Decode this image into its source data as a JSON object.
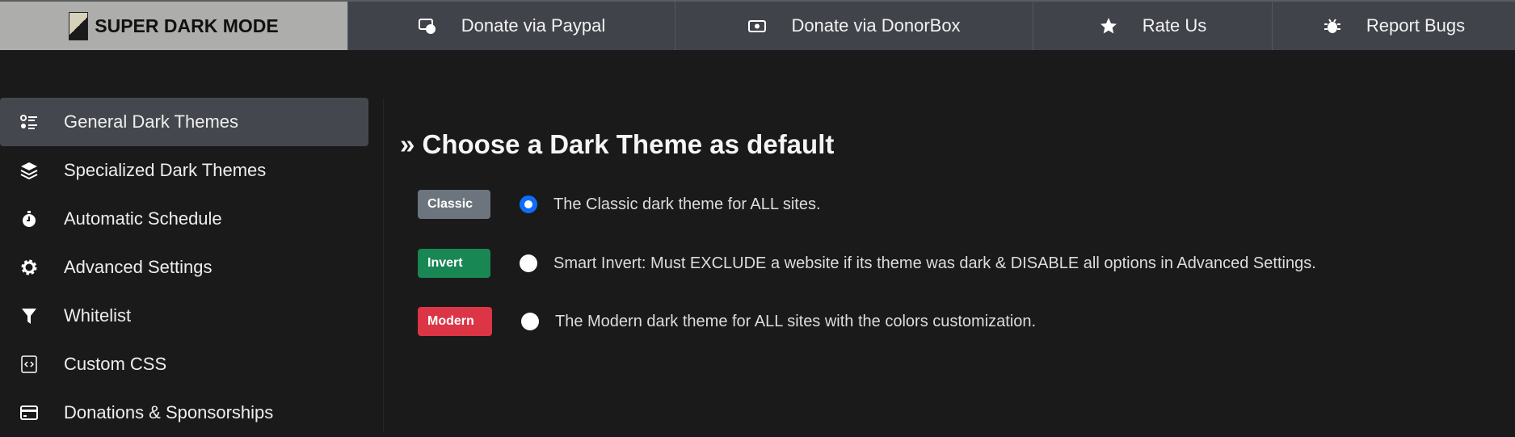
{
  "header": {
    "brand": "SUPER DARK MODE",
    "nav": [
      {
        "label": "Donate via Paypal",
        "icon": "money-check-dollar-icon"
      },
      {
        "label": "Donate via DonorBox",
        "icon": "money-bill-icon"
      },
      {
        "label": "Rate Us",
        "icon": "star-icon"
      },
      {
        "label": "Report Bugs",
        "icon": "bug-icon"
      }
    ]
  },
  "sidebar": {
    "items": [
      {
        "label": "General Dark Themes",
        "icon": "list-icon",
        "active": true
      },
      {
        "label": "Specialized Dark Themes",
        "icon": "layers-icon"
      },
      {
        "label": "Automatic Schedule",
        "icon": "stopwatch-icon"
      },
      {
        "label": "Advanced Settings",
        "icon": "gear-icon"
      },
      {
        "label": "Whitelist",
        "icon": "filter-icon"
      },
      {
        "label": "Custom CSS",
        "icon": "code-icon"
      },
      {
        "label": "Donations & Sponsorships",
        "icon": "credit-card-icon"
      }
    ]
  },
  "main": {
    "heading": "» Choose a Dark Theme as default",
    "options": [
      {
        "badge": "Classic",
        "badge_color": "#6c757d",
        "text": "The Classic dark theme for ALL sites.",
        "selected": true
      },
      {
        "badge": "Invert",
        "badge_color": "#198754",
        "text": "Smart Invert: Must EXCLUDE a website if its theme was dark & DISABLE all options in Advanced Settings.",
        "selected": false
      },
      {
        "badge": "Modern",
        "badge_color": "#dc3545",
        "text": "The Modern dark theme for ALL sites with the colors customization.",
        "selected": false
      }
    ]
  }
}
